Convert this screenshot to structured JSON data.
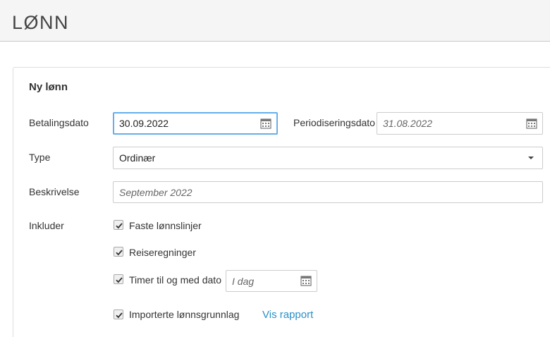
{
  "header": {
    "title": "LØNN"
  },
  "form": {
    "title": "Ny lønn",
    "payment_date": {
      "label": "Betalingsdato",
      "value": "30.09.2022"
    },
    "accrual_date": {
      "label": "Periodiseringsdato",
      "placeholder": "31.08.2022"
    },
    "type": {
      "label": "Type",
      "selected": "Ordinær"
    },
    "description": {
      "label": "Beskrivelse",
      "placeholder": "September 2022"
    },
    "include": {
      "label": "Inkluder",
      "options": [
        {
          "label": "Faste lønnslinjer",
          "checked": true
        },
        {
          "label": "Reiseregninger",
          "checked": true
        },
        {
          "label": "Timer til og med dato",
          "checked": true
        },
        {
          "label": "Importerte lønnsgrunnlag",
          "checked": true
        }
      ],
      "hours_until_date": {
        "placeholder": "I dag"
      },
      "report_link": "Vis rapport"
    }
  },
  "icons": {
    "calendar": "calendar-icon",
    "dropdown": "caret-down-icon",
    "check": "check-icon"
  },
  "colors": {
    "focus_border": "#66afe9",
    "link": "#2a8fc8"
  }
}
